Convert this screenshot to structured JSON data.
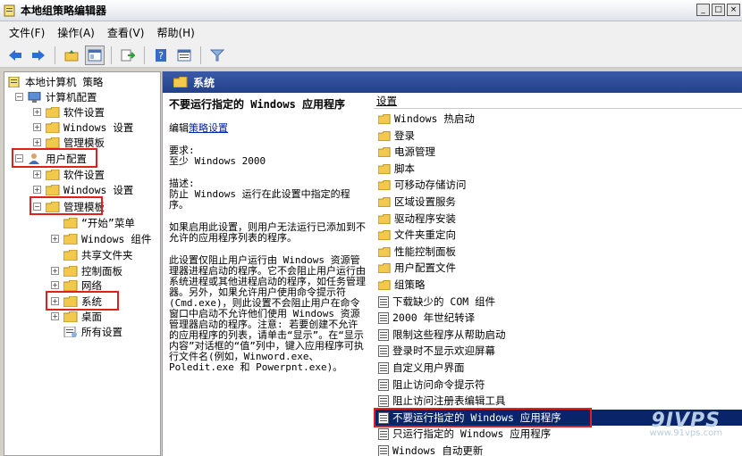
{
  "window": {
    "title": "本地组策略编辑器",
    "controls": [
      "_",
      "□",
      "×"
    ]
  },
  "menu": [
    "文件(F)",
    "操作(A)",
    "查看(V)",
    "帮助(H)"
  ],
  "toolbar": {
    "icons": [
      "back-arrow-icon",
      "forward-arrow-icon",
      "up-folder-icon",
      "show-hide-tree-icon",
      "export-list-icon",
      "help-icon",
      "properties-icon",
      "filter-icon"
    ],
    "accent": "#2a6fd6"
  },
  "tree": {
    "root": "本地计算机 策略",
    "computer": "计算机配置",
    "computer_software": "软件设置",
    "computer_windows": "Windows 设置",
    "computer_admin": "管理模板",
    "user": "用户配置",
    "user_software": "软件设置",
    "user_windows": "Windows 设置",
    "user_admin": "管理模板",
    "start_menu": "“开始”菜单",
    "windows_components": "Windows 组件",
    "shared_folders": "共享文件夹",
    "control_panel": "控制面板",
    "network": "网络",
    "system": "系统",
    "desktop": "桌面",
    "all_settings": "所有设置"
  },
  "header": {
    "title": "系统"
  },
  "description": {
    "policy_title": "不要运行指定的 Windows 应用程序",
    "edit_prefix": "编辑",
    "edit_link": "策略设置",
    "requirements": "要求:\n至少 Windows 2000",
    "desc": "描述:\n防止 Windows 运行在此设置中指定的程序。",
    "para1": "如果启用此设置，则用户无法运行已添加到不允许的应用程序列表的程序。",
    "para2": "此设置仅阻止用户运行由 Windows 资源管理器进程启动的程序。它不会阻止用户运行由系统进程或其他进程启动的程序，如任务管理器。另外，如果允许用户使用命令提示符(Cmd.exe)，则此设置不会阻止用户在命令窗口中启动不允许他们使用 Windows 资源管理器启动的程序。注意: 若要创建不允许的应用程序的列表，请单击“显示”。在“显示内容”对话框的“值”列中，键入应用程序可执行文件名(例如，Winword.exe、Poledit.exe 和 Powerpnt.exe)。"
  },
  "list": {
    "column": "设置",
    "folders": [
      "Windows 热启动",
      "登录",
      "电源管理",
      "脚本",
      "可移动存储访问",
      "区域设置服务",
      "驱动程序安装",
      "文件夹重定向",
      "性能控制面板",
      "用户配置文件",
      "组策略"
    ],
    "settings": [
      "下载缺少的 COM 组件",
      "2000 年世纪转译",
      "限制这些程序从帮助启动",
      "登录时不显示欢迎屏幕",
      "自定义用户界面",
      "阻止访问命令提示符",
      "阻止访问注册表编辑工具",
      "不要运行指定的 Windows 应用程序",
      "只运行指定的 Windows 应用程序",
      "Windows 自动更新"
    ],
    "selected": "不要运行指定的 Windows 应用程序"
  },
  "watermark": {
    "logo": "9IVPS",
    "url": "www.91vps.com"
  },
  "colors": {
    "selection": "#0a246a",
    "highlight_box": "#e0201c",
    "header_bar": "#2d4c98"
  }
}
